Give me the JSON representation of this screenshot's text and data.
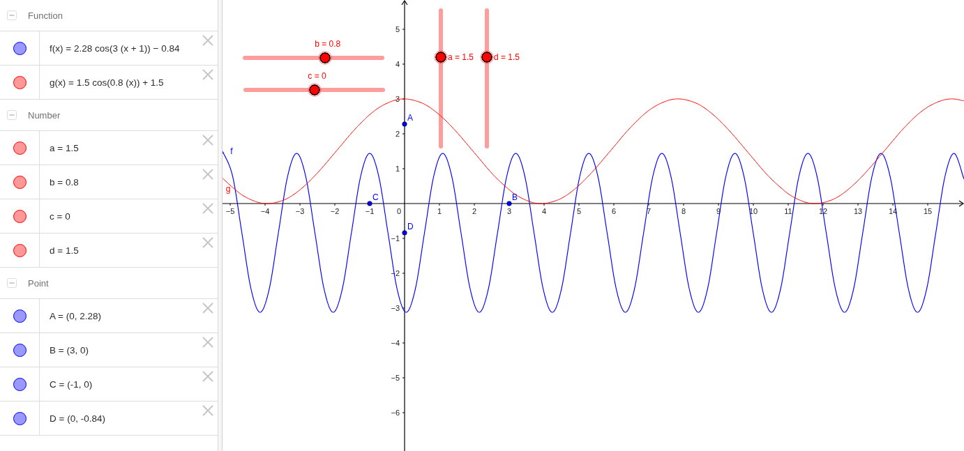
{
  "algebra_view": {
    "groups": [
      {
        "title": "Function",
        "expanded": true,
        "items": [
          {
            "text": "f(x) = 2.28 cos(3 (x + 1)) − 0.84",
            "color": "#9999ff"
          },
          {
            "text": "g(x) = 1.5 cos(0.8 (x)) + 1.5",
            "color": "#ff9999"
          }
        ]
      },
      {
        "title": "Number",
        "expanded": true,
        "items": [
          {
            "text": "a = 1.5",
            "color": "#ff9999"
          },
          {
            "text": "b = 0.8",
            "color": "#ff9999"
          },
          {
            "text": "c = 0",
            "color": "#ff9999"
          },
          {
            "text": "d = 1.5",
            "color": "#ff9999"
          }
        ]
      },
      {
        "title": "Point",
        "expanded": true,
        "items": [
          {
            "text": "A = (0, 2.28)",
            "color": "#9999ff"
          },
          {
            "text": "B = (3, 0)",
            "color": "#9999ff"
          },
          {
            "text": "C = (-1, 0)",
            "color": "#9999ff"
          },
          {
            "text": "D = (0, -0.84)",
            "color": "#9999ff"
          }
        ]
      }
    ]
  },
  "graphics_view": {
    "sliders": [
      {
        "label": "b = 0.8",
        "kind": "horizontal",
        "level": 0.58
      },
      {
        "label": "c = 0",
        "kind": "horizontal",
        "level": 0.5
      },
      {
        "label": "a = 1.5",
        "kind": "vertical",
        "level": 0.65
      },
      {
        "label": "d = 1.5",
        "kind": "vertical",
        "level": 0.65
      }
    ],
    "chart_data": {
      "type": "line",
      "x": [
        -5.22,
        -5.189,
        -4.927,
        -4.665,
        -4.403,
        -4.142,
        -3.88,
        -3.618,
        -3.356,
        -3.094,
        -2.833,
        -2.571,
        -2.309,
        -2.047,
        -1.785,
        -1.524,
        -1.262,
        -1,
        -0.738,
        -0.476,
        -0.215,
        0.047,
        0.309,
        0.571,
        0.833,
        1.094,
        1.356,
        1.618,
        1.88,
        2.142,
        2.403,
        2.665,
        2.927,
        3.189,
        3.451,
        3.712,
        3.974,
        4.236,
        4.498,
        4.76,
        5.021,
        5.283,
        5.545,
        5.807,
        6.069,
        6.33,
        6.592,
        6.854,
        7.116,
        7.378,
        7.639,
        7.901,
        8.163,
        8.425,
        8.687,
        8.948,
        9.21,
        9.472,
        9.734,
        9.996,
        10.257,
        10.519,
        10.781,
        11.043,
        11.305,
        11.566,
        11.828,
        12.09,
        12.352,
        12.614,
        12.875,
        13.137,
        13.399,
        13.661,
        13.923,
        14.184,
        14.446,
        14.708,
        14.97,
        15.232,
        15.493,
        15.755,
        16.017,
        16.04
      ],
      "series": [
        {
          "name": "f",
          "color": "#0000ff",
          "values": [
            1.43,
            1.44,
            0.77,
            -0.84,
            -2.45,
            -3.12,
            -2.45,
            -0.84,
            0.77,
            1.44,
            0.77,
            -0.84,
            -2.45,
            -3.12,
            -2.45,
            -0.84,
            0.77,
            1.44,
            0.77,
            -0.84,
            -2.45,
            -3.12,
            -2.45,
            -0.84,
            0.77,
            1.44,
            0.77,
            -0.84,
            -2.45,
            -3.12,
            -2.45,
            -0.84,
            0.77,
            1.44,
            0.77,
            -0.84,
            -2.45,
            -3.12,
            -2.45,
            -0.84,
            0.77,
            1.44,
            0.77,
            -0.84,
            -2.45,
            -3.12,
            -2.45,
            -0.84,
            0.77,
            1.44,
            0.77,
            -0.84,
            -2.45,
            -3.12,
            -2.45,
            -0.84,
            0.77,
            1.44,
            0.77,
            -0.84,
            -2.45,
            -3.12,
            -2.45,
            -0.84,
            0.77,
            1.44,
            0.77,
            -0.84,
            -2.45,
            -3.12,
            -2.45,
            -0.84,
            0.77,
            1.44,
            0.77,
            -0.84,
            -2.45,
            -3.12,
            -2.45,
            -0.84,
            0.77,
            1.44,
            0.77,
            0.66
          ]
        },
        {
          "name": "g",
          "color": "#ff0000",
          "values": [
            0.73,
            0.7,
            0.46,
            0.25,
            0.11,
            0.02,
            0,
            0.05,
            0.15,
            0.32,
            0.54,
            0.8,
            1.09,
            1.4,
            1.71,
            2.02,
            2.3,
            2.55,
            2.75,
            2.89,
            2.98,
            3,
            2.95,
            2.85,
            2.68,
            2.46,
            2.2,
            1.91,
            1.6,
            1.29,
            0.98,
            0.7,
            0.46,
            0.25,
            0.11,
            0.02,
            0,
            0.05,
            0.15,
            0.32,
            0.54,
            0.8,
            1.09,
            1.4,
            1.71,
            2.02,
            2.3,
            2.55,
            2.75,
            2.89,
            2.98,
            3,
            2.95,
            2.85,
            2.68,
            2.46,
            2.2,
            1.91,
            1.6,
            1.29,
            0.98,
            0.7,
            0.46,
            0.25,
            0.11,
            0.02,
            0,
            0.05,
            0.15,
            0.32,
            0.54,
            0.8,
            1.09,
            1.4,
            1.71,
            2.02,
            2.3,
            2.55,
            2.75,
            2.89,
            2.98,
            3,
            2.95,
            2.95
          ]
        }
      ],
      "xlim": [
        -5.22,
        16.04
      ],
      "ylim": [
        -7.1,
        5.84
      ],
      "xticks": [
        {
          "value": -5,
          "label": "−5"
        },
        {
          "value": -4,
          "label": "−4"
        },
        {
          "value": -3,
          "label": "−3"
        },
        {
          "value": -2,
          "label": "−2"
        },
        {
          "value": -1,
          "label": "−1"
        },
        0,
        1,
        2,
        3,
        4,
        5,
        6,
        7,
        8,
        9,
        10,
        11,
        12,
        13,
        14,
        15
      ],
      "yticks": [
        {
          "value": -6,
          "label": "−6"
        },
        {
          "value": -5,
          "label": "−5"
        },
        {
          "value": -4,
          "label": "−4"
        },
        {
          "value": -3,
          "label": "−3"
        },
        {
          "value": -2,
          "label": "−2"
        },
        {
          "value": -1,
          "label": "−1"
        },
        1,
        2,
        3,
        4,
        5
      ],
      "annotations": [
        {
          "text": "A",
          "x": 0,
          "y": 2.28
        },
        {
          "text": "B",
          "x": 3,
          "y": 0
        },
        {
          "text": "C",
          "x": -1,
          "y": 0
        },
        {
          "text": "D",
          "x": 0,
          "y": -0.84
        }
      ]
    }
  }
}
